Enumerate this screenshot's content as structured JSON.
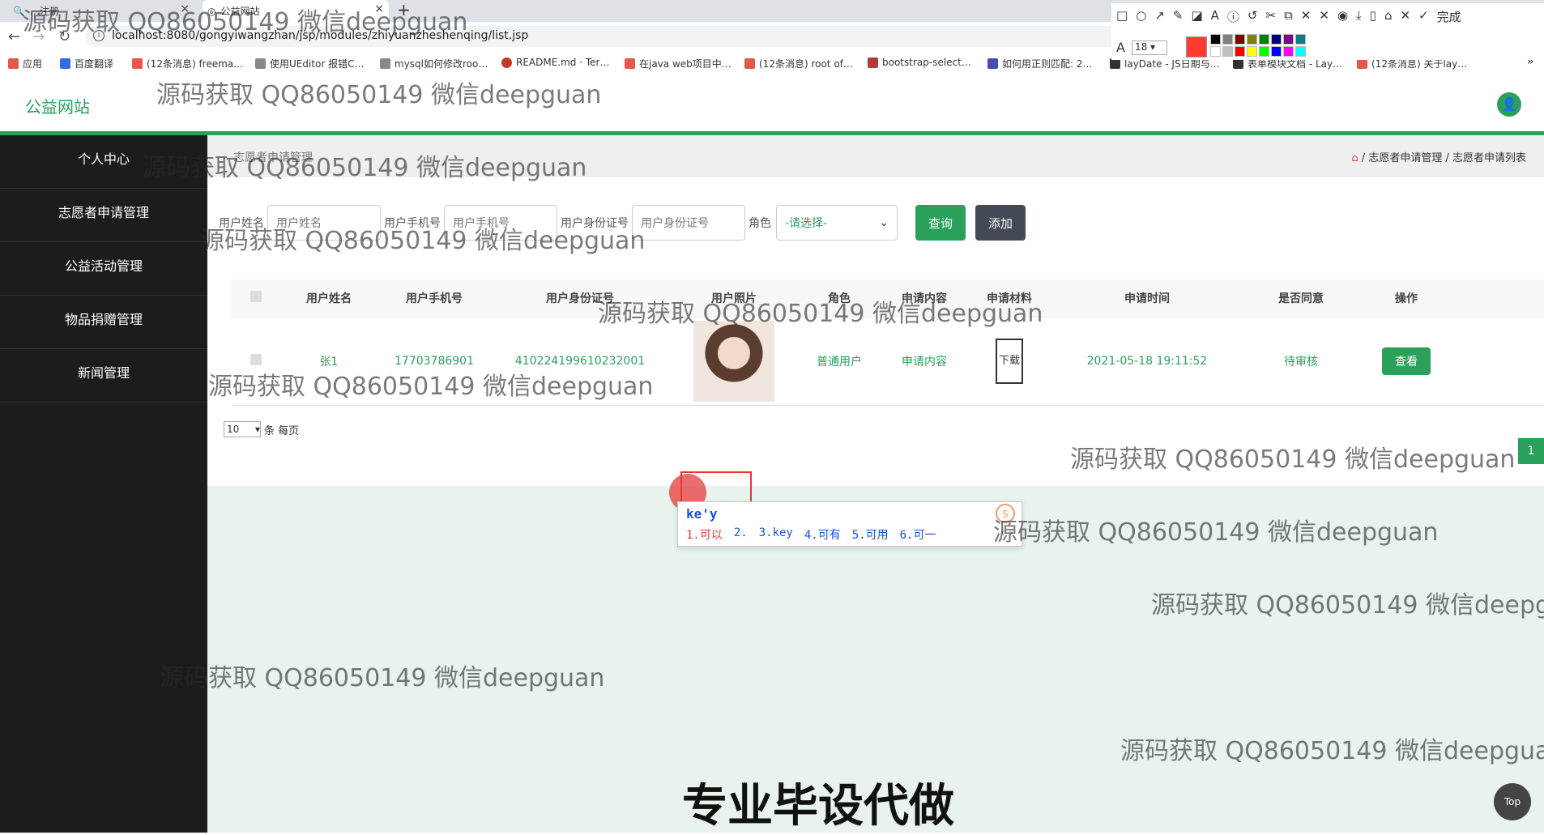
{
  "browser": {
    "tabs": [
      {
        "label": "…注册",
        "close": "×"
      },
      {
        "label": "公益网站",
        "close": "×"
      }
    ],
    "new_tab": "+",
    "url": "localhost:8080/gongyiwangzhan/jsp/modules/zhiyuanzheshenqing/list.jsp",
    "bookmarks": [
      {
        "label": "应用",
        "color": "#e2584b"
      },
      {
        "label": "百度翻译",
        "color": "#2f6fde"
      },
      {
        "label": "(12条消息) freema…",
        "color": "#e2584b"
      },
      {
        "label": "使用UEditor 报错C…",
        "color": "#888888"
      },
      {
        "label": "mysql如何修改roo…",
        "color": "#888888"
      },
      {
        "label": "README.md · Ter…",
        "color": "#c0392b"
      },
      {
        "label": "在java web项目中…",
        "color": "#e2584b"
      },
      {
        "label": "(12条消息) root of…",
        "color": "#e2584b"
      },
      {
        "label": "bootstrap-select…",
        "color": "#b23a3a"
      },
      {
        "label": "如何用正则匹配: 2…",
        "color": "#4a4ab5"
      },
      {
        "label": "layDate - JS日期与…",
        "color": "#333333"
      },
      {
        "label": "表单模块文档 - Lay…",
        "color": "#333333"
      },
      {
        "label": "(12条消息) 关于lay…",
        "color": "#e2584b"
      }
    ]
  },
  "annotation_tool": {
    "tools": [
      "□",
      "○",
      "↗",
      "✎",
      "◪",
      "A",
      "ⓘ",
      "↺",
      "✂",
      "⧉",
      "✕",
      "✕",
      "◉",
      "⤓",
      "▯",
      "⌂",
      "✕",
      "✓",
      "完成"
    ],
    "font_icon": "A",
    "font_size": "18",
    "main_color": "#ff3b30",
    "palette": [
      "#000000",
      "#808080",
      "#800000",
      "#808000",
      "#008000",
      "#000080",
      "#800080",
      "#008080",
      "#ffffff",
      "#c0c0c0",
      "#ff0000",
      "#ffff00",
      "#00ff00",
      "#0000ff",
      "#ff00ff",
      "#00ffff"
    ]
  },
  "app": {
    "logo": "公益网站",
    "avatar_icon": "user-icon",
    "accent": "#2aa05b"
  },
  "sidebar": {
    "items": [
      {
        "label": "个人中心"
      },
      {
        "label": "志愿者申请管理"
      },
      {
        "label": "公益活动管理"
      },
      {
        "label": "物品捐赠管理"
      },
      {
        "label": "新闻管理"
      }
    ]
  },
  "main": {
    "page_title": "志愿者申请管理",
    "breadcrumb": [
      "志愿者申请管理",
      "志愿者申请列表"
    ],
    "search": {
      "name_label": "用户姓名",
      "name_placeholder": "用户姓名",
      "phone_label": "用户手机号",
      "phone_placeholder": "用户手机号",
      "id_label": "用户身份证号",
      "id_placeholder": "用户身份证号",
      "role_label": "角色",
      "role_value": "-请选择-",
      "query_button": "查询",
      "add_button": "添加"
    },
    "table": {
      "headers": [
        "用户姓名",
        "用户手机号",
        "用户身份证号",
        "用户照片",
        "角色",
        "申请内容",
        "申请材料",
        "申请时间",
        "是否同意",
        "操作"
      ],
      "rows": [
        {
          "name": "张1",
          "phone": "17703786901",
          "id_number": "410224199610232001",
          "role": "普通用户",
          "content": "申请内容",
          "material": "下载",
          "time": "2021-05-18 19:11:52",
          "status": "待审核",
          "action": "查看"
        }
      ]
    },
    "pagination": {
      "page_size": "10",
      "per_page_text": "条 每页",
      "current_page": "1"
    }
  },
  "ime": {
    "composition": "ke'y",
    "candidates": [
      "1.可以",
      "2.",
      "3.key",
      "4.可有",
      "5.可用",
      "6.可一"
    ],
    "nav": "‹ ›",
    "logo": "S"
  },
  "top_button": "Top",
  "watermark": "源码获取 QQ86050149 微信deepguan",
  "ad_banner": "专业毕设代做"
}
